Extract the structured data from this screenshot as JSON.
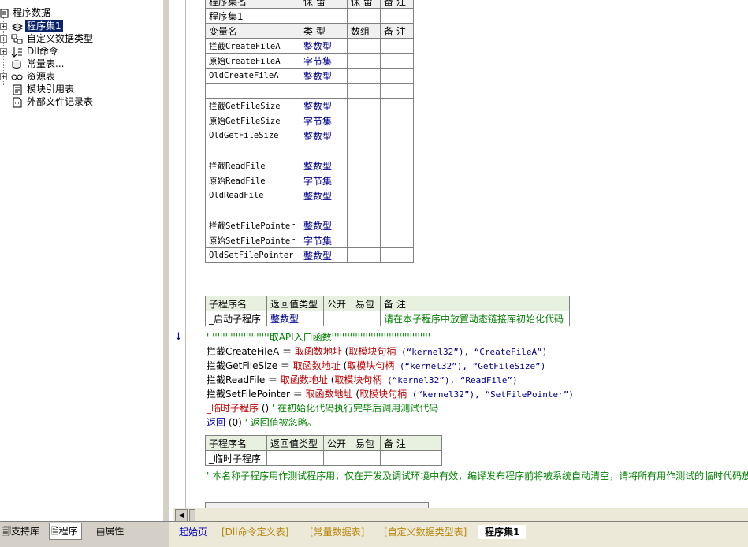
{
  "tree": {
    "root": "程序数据",
    "items": [
      {
        "label": "程序集1",
        "icon": "assembly-icon",
        "expander": "+",
        "selected": true
      },
      {
        "label": "自定义数据类型",
        "icon": "datatype-icon",
        "expander": "+"
      },
      {
        "label": "Dll命令",
        "icon": "dll-icon",
        "expander": "+"
      },
      {
        "label": "常量表...",
        "icon": "constant-icon",
        "expander": ""
      },
      {
        "label": "资源表",
        "icon": "resource-icon",
        "expander": "+"
      },
      {
        "label": "模块引用表",
        "icon": "module-icon",
        "expander": ""
      },
      {
        "label": "外部文件记录表",
        "icon": "file-icon",
        "expander": ""
      }
    ]
  },
  "assembly_table": {
    "top_header": [
      "程序集名",
      "保 留",
      "保 留",
      "备 注"
    ],
    "name": "程序集1",
    "var_header": [
      "变量名",
      "类 型",
      "数组",
      "备 注"
    ],
    "rows": [
      {
        "name": "拦截CreateFileA",
        "type": "整数型"
      },
      {
        "name": "原始CreateFileA",
        "type": "字节集"
      },
      {
        "name": "OldCreateFileA",
        "type": "整数型"
      },
      {
        "name": "",
        "type": ""
      },
      {
        "name": "拦截GetFileSize",
        "type": "整数型"
      },
      {
        "name": "原始GetFileSize",
        "type": "字节集"
      },
      {
        "name": "OldGetFileSize",
        "type": "整数型"
      },
      {
        "name": "",
        "type": ""
      },
      {
        "name": "拦截ReadFile",
        "type": "整数型"
      },
      {
        "name": "原始ReadFile",
        "type": "字节集"
      },
      {
        "name": "OldReadFile",
        "type": "整数型"
      },
      {
        "name": "",
        "type": ""
      },
      {
        "name": "拦截SetFilePointer",
        "type": "整数型"
      },
      {
        "name": "原始SetFilePointer",
        "type": "字节集"
      },
      {
        "name": "OldSetFilePointer",
        "type": "整数型"
      }
    ]
  },
  "sub1": {
    "header": [
      "子程序名",
      "返回值类型",
      "公开",
      "易包",
      "备 注"
    ],
    "name": "_启动子程序",
    "return_type": "整数型",
    "note": "请在本子程序中放置动态链接库初始化代码"
  },
  "code": {
    "comment_line": "' ''''''''''''''''''''''取API入口函数''''''''''''''''''''''''''''''''''''''",
    "lines": [
      {
        "var": "拦截CreateFileA",
        "eq": " ＝ ",
        "fn": "取函数地址",
        "open": " (",
        "fn2": "取模块句柄",
        "args": " (“kernel32”), “CreateFileA”)"
      },
      {
        "var": "拦截GetFileSize",
        "eq": " ＝ ",
        "fn": "取函数地址",
        "open": " (",
        "fn2": "取模块句柄",
        "args": " (“kernel32”), “GetFileSize”)"
      },
      {
        "var": "拦截ReadFile",
        "eq": " ＝ ",
        "fn": "取函数地址",
        "open": " (",
        "fn2": "取模块句柄",
        "args": " (“kernel32”), “ReadFile”)"
      },
      {
        "var": "拦截SetFilePointer",
        "eq": " ＝ ",
        "fn": "取函数地址",
        "open": " (",
        "fn2": "取模块句柄",
        "args": " (“kernel32”), “SetFilePointer”)"
      }
    ],
    "call_line": {
      "fn": "_临时子程序",
      "args": " ()",
      "comment": "  ' 在初始化代码执行完毕后调用测试代码"
    },
    "return_line": {
      "kw": "返回",
      "args": " (0)",
      "comment": "  ' 返回值被忽略。"
    }
  },
  "sub2": {
    "header": [
      "子程序名",
      "返回值类型",
      "公开",
      "易包",
      "备 注"
    ],
    "name": "_临时子程序",
    "comment": "' 本名称子程序用作测试程序用，仅在开发及调试环境中有效，编译发布程序前将被系统自动清空，请将所有用作测试的临时代码放"
  },
  "left_tabs": [
    {
      "label": "支持库",
      "icon": "library-icon"
    },
    {
      "label": "程序",
      "icon": "program-icon",
      "active": true
    },
    {
      "label": "属性",
      "icon": "property-icon"
    }
  ],
  "editor_tabs": [
    {
      "label": "起始页",
      "style": "blue"
    },
    {
      "label": "[Dll命令定义表]",
      "style": "gold"
    },
    {
      "label": "[常量数据表]",
      "style": "gold"
    },
    {
      "label": "[自定义数据类型表]",
      "style": "gold"
    },
    {
      "label": "程序集1",
      "style": "active"
    }
  ],
  "colors": {
    "selection": "#0a246a",
    "type_text": "#00008b",
    "comment": "#008000",
    "function": "#c00000",
    "keyword": "#0000c0"
  }
}
